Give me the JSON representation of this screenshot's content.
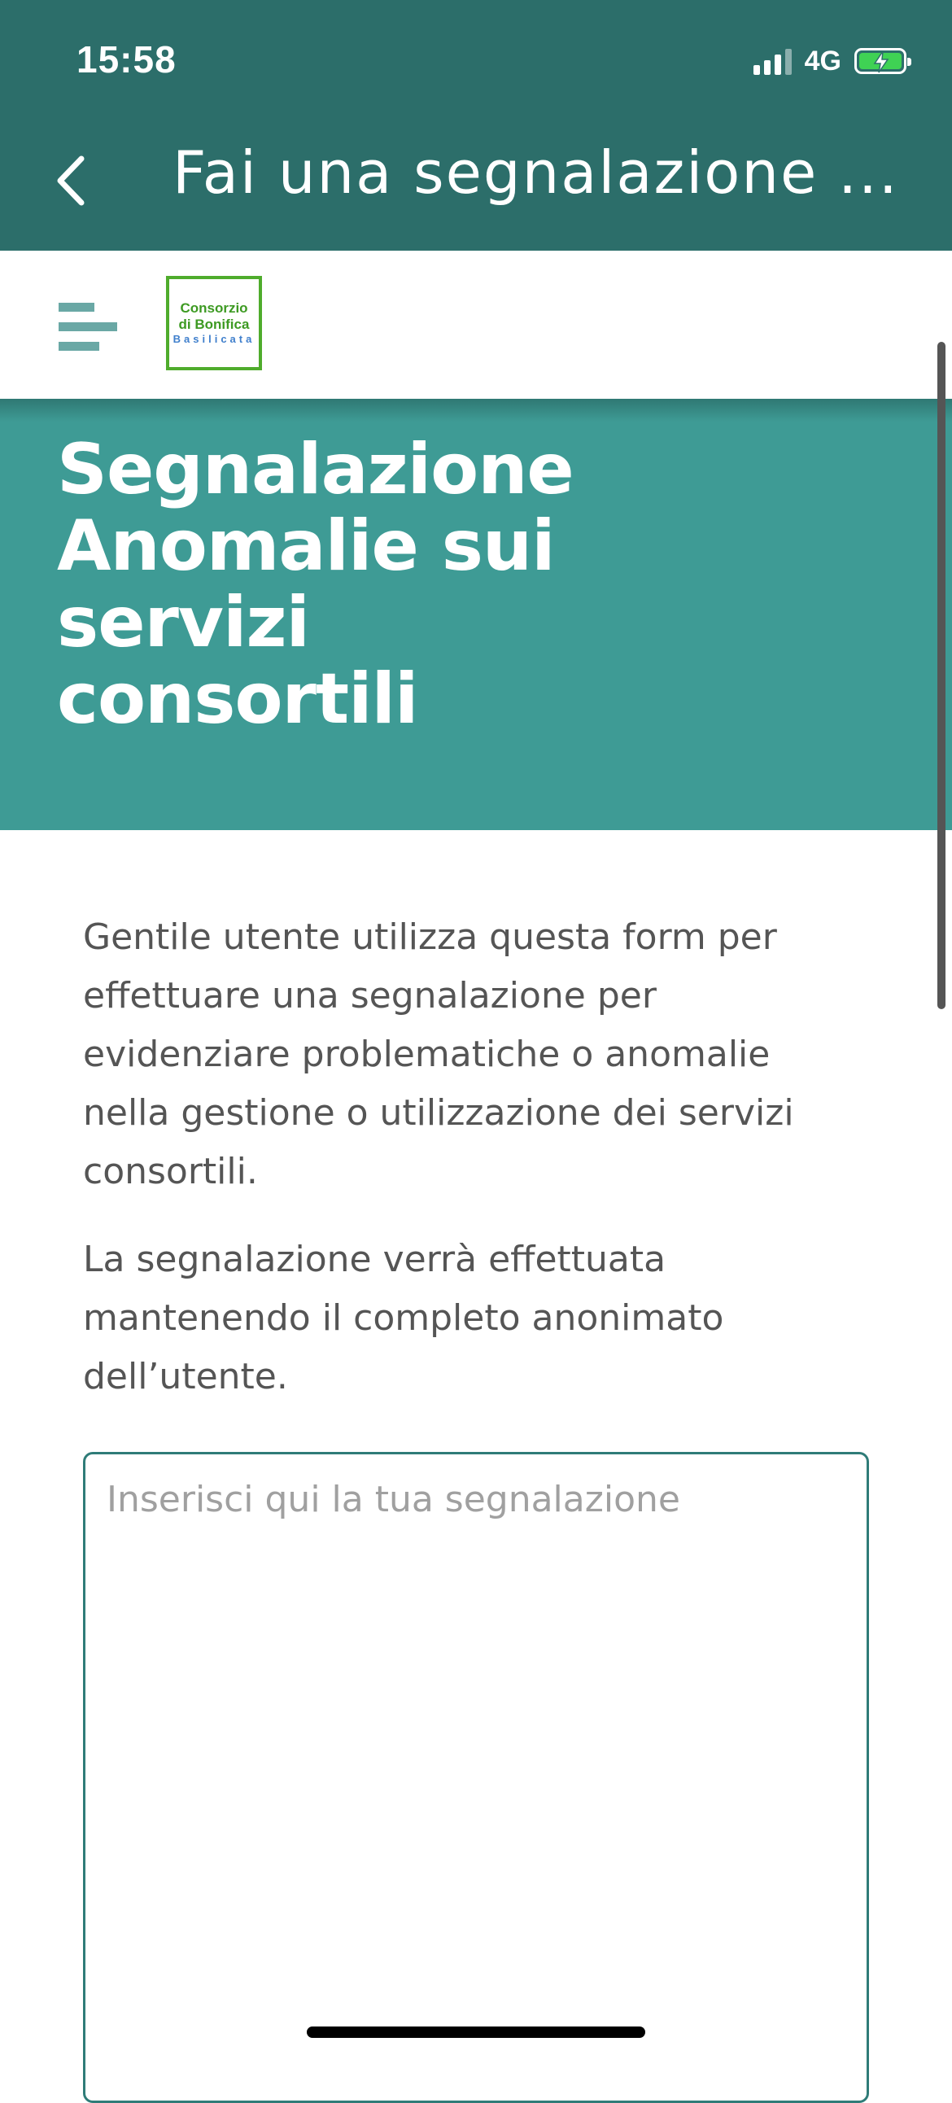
{
  "status_bar": {
    "time": "15:58",
    "network": "4G",
    "battery_icon": "battery-charging-icon"
  },
  "header": {
    "title": "Fai una segnalazione ...",
    "back_icon": "chevron-left-icon",
    "background_color": "#2c6e6a"
  },
  "subheader": {
    "menu_icon": "hamburger-menu-icon",
    "logo": {
      "line1": "Consorzio",
      "line2": "di Bonifica",
      "line3": "Basilicata"
    }
  },
  "hero": {
    "title": "Segnalazione Anomalie sui servizi consortili",
    "background_color": "#3e9b95"
  },
  "intro": {
    "paragraph1": "Gentile utente utilizza questa form per effettuare una segnalazione per evidenziare problematiche o anomalie nella gestione o utilizzazione dei servizi consortili.",
    "paragraph2": "La segnalazione verrà effettuata mantenendo il completo anonimato dell’utente."
  },
  "form": {
    "report_placeholder": "Inserisci qui la tua segnalazione",
    "report_value": ""
  }
}
